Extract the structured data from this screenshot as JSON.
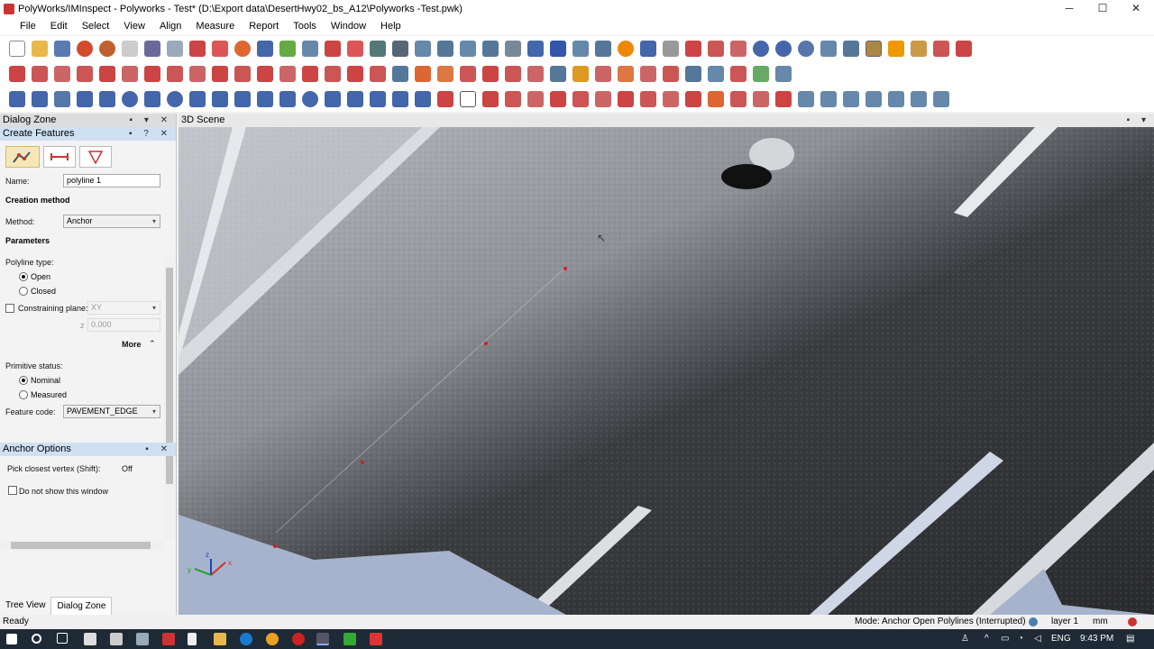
{
  "window": {
    "title": "PolyWorks/IMInspect - Polyworks - Test* (D:\\Export data\\DesertHwy02_bs_A12\\Polyworks -Test.pwk)",
    "minimize": "─",
    "maximize": "☐",
    "close": "✕"
  },
  "menu": [
    "File",
    "Edit",
    "Select",
    "View",
    "Align",
    "Measure",
    "Report",
    "Tools",
    "Window",
    "Help"
  ],
  "dialog_zone": {
    "title": "Dialog Zone",
    "create_features": {
      "title": "Create Features",
      "name_label": "Name:",
      "name_value": "polyline 1",
      "creation_method_heading": "Creation method",
      "method_label": "Method:",
      "method_value": "Anchor",
      "parameters_heading": "Parameters",
      "polyline_type_label": "Polyline type:",
      "open_label": "Open",
      "closed_label": "Closed",
      "constraining_plane_label": "Constraining plane:",
      "plane_value": "XY",
      "plane_offset": "0.000",
      "offset_axis": "z",
      "more_label": "More",
      "primitive_status_label": "Primitive status:",
      "nominal_label": "Nominal",
      "measured_label": "Measured",
      "feature_code_label": "Feature code:",
      "feature_code_value": "PAVEMENT_EDGE"
    },
    "anchor_options": {
      "title": "Anchor Options",
      "pick_closest_label": "Pick closest vertex (Shift):",
      "pick_closest_value": "Off",
      "dont_show_label": "Do not show this window"
    },
    "tabs": [
      "Tree View",
      "Dialog Zone"
    ]
  },
  "scene": {
    "title": "3D Scene",
    "axis_labels": {
      "x": "x",
      "y": "y",
      "z": "z"
    }
  },
  "status": {
    "left": "Ready",
    "mode": "Mode: Anchor Open Polylines (Interrupted)",
    "layer": "layer 1",
    "unit": "mm"
  },
  "taskbar": {
    "lang": "ENG",
    "time": "9:43 PM"
  },
  "colors": {
    "accent": "#cfe0f3",
    "selected_tool": "#f5e7b8",
    "taskbar": "#1e2a35",
    "anchor_point": "#d0202a"
  }
}
